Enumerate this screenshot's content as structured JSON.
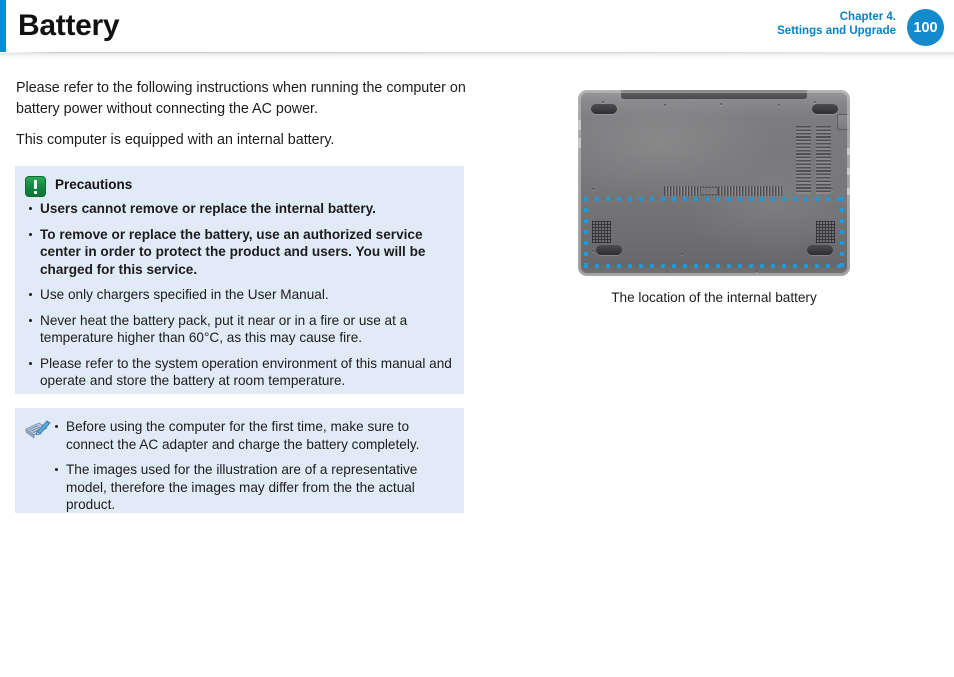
{
  "header": {
    "title": "Battery",
    "chapter_line1": "Chapter 4.",
    "chapter_line2": "Settings and Upgrade",
    "page_number": "100",
    "accent_color": "#0c8bd0",
    "chapter_text_color": "#0c7fc4",
    "badge_color": "#1489cc"
  },
  "intro": {
    "paragraph1": "Please refer to the following instructions when running the computer on battery power without connecting the AC power.",
    "paragraph2": "This computer is equipped with an internal battery."
  },
  "precautions": {
    "icon": "warning-exclamation-icon",
    "title": "Precautions",
    "background_color": "#e1ebf7",
    "items": [
      {
        "text": "Users cannot remove or replace the internal battery.",
        "bold": true
      },
      {
        "text": "To remove or replace the battery, use an authorized service center in order to protect the product and users. You will be charged for this service.",
        "bold": true
      },
      {
        "text": "Use only chargers specified in the User Manual.",
        "bold": false
      },
      {
        "text": "Never heat the battery pack, put it near or in a fire or use at a temperature higher than 60°C, as this may cause fire.",
        "bold": false
      },
      {
        "text": "Please refer to the system operation environment of this manual and operate and store the battery at room temperature.",
        "bold": false
      }
    ]
  },
  "note": {
    "icon": "note-pencil-icon",
    "background_color": "#e1ebf7",
    "items": [
      {
        "text": "Before using the computer for the first time, make sure to connect the AC adapter and charge the battery completely."
      },
      {
        "text": "The images used for the illustration are of a representative model, therefore the images may differ from the the actual product."
      }
    ]
  },
  "figure": {
    "alt": "laptop-bottom-view",
    "highlight_color": "#1c9ad9",
    "caption": "The location of the internal battery"
  }
}
